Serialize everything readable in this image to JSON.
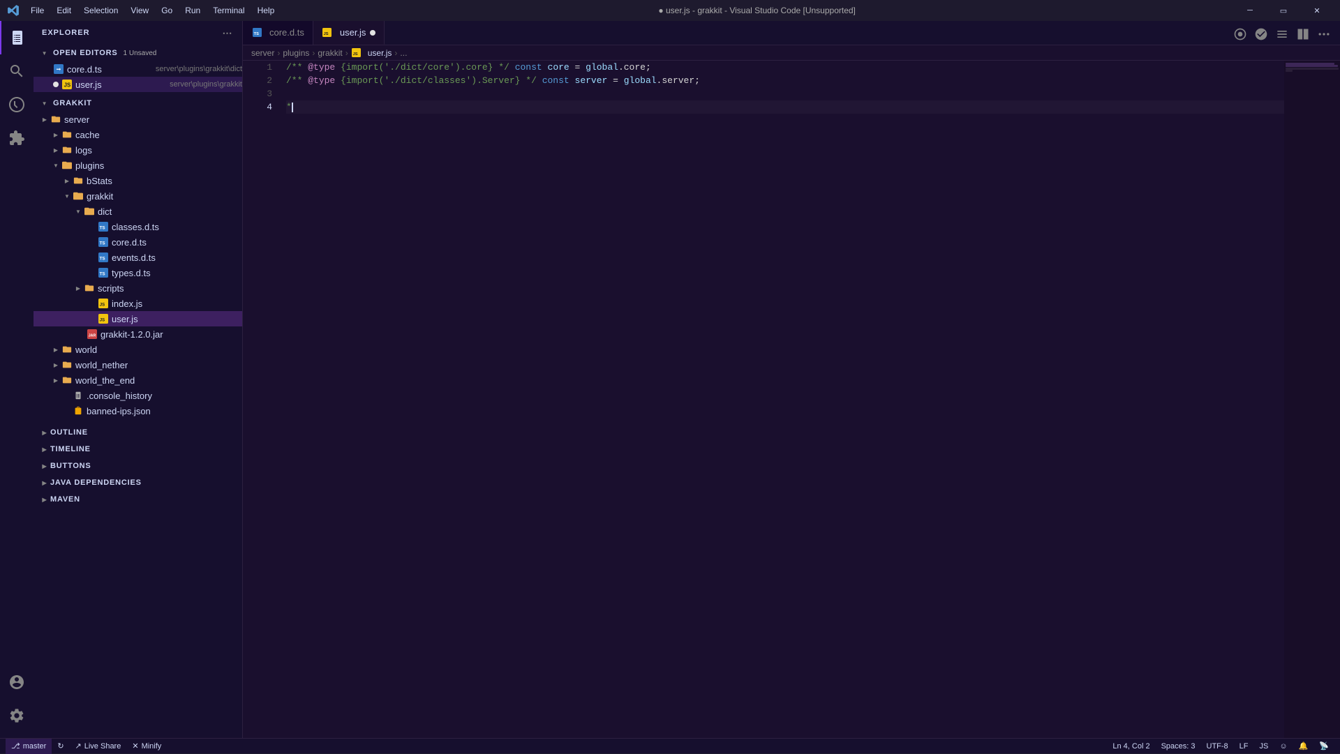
{
  "titleBar": {
    "title": "● user.js - grakkit - Visual Studio Code [Unsupported]",
    "menu": [
      "File",
      "Edit",
      "Selection",
      "View",
      "Go",
      "Run",
      "Terminal",
      "Help"
    ],
    "buttons": [
      "minimize",
      "restore",
      "close"
    ]
  },
  "sidebar": {
    "header": "Explorer",
    "openEditors": {
      "label": "Open Editors",
      "badge": "1",
      "unsaved": "1 Unsaved",
      "items": [
        {
          "name": "core.d.ts",
          "path": "server\\plugins\\grakkit\\dict",
          "icon": "ts",
          "unsaved": false
        },
        {
          "name": "user.js",
          "path": "server\\plugins\\grakkit",
          "icon": "js",
          "unsaved": true
        }
      ]
    },
    "grakkit": {
      "label": "GRAKKIT",
      "expanded": true,
      "items": [
        {
          "type": "folder",
          "name": "server",
          "level": 1,
          "expanded": false,
          "arrow": "right"
        },
        {
          "type": "folder",
          "name": "cache",
          "level": 2,
          "expanded": false,
          "arrow": "right"
        },
        {
          "type": "folder",
          "name": "logs",
          "level": 2,
          "expanded": false,
          "arrow": "right"
        },
        {
          "type": "folder",
          "name": "plugins",
          "level": 2,
          "expanded": true,
          "arrow": "down"
        },
        {
          "type": "folder",
          "name": "bStats",
          "level": 3,
          "expanded": false,
          "arrow": "right"
        },
        {
          "type": "folder",
          "name": "grakkit",
          "level": 3,
          "expanded": true,
          "arrow": "down"
        },
        {
          "type": "folder",
          "name": "dict",
          "level": 4,
          "expanded": true,
          "arrow": "down"
        },
        {
          "type": "file",
          "name": "classes.d.ts",
          "level": 5,
          "icon": "ts"
        },
        {
          "type": "file",
          "name": "core.d.ts",
          "level": 5,
          "icon": "ts"
        },
        {
          "type": "file",
          "name": "events.d.ts",
          "level": 5,
          "icon": "ts"
        },
        {
          "type": "file",
          "name": "types.d.ts",
          "level": 5,
          "icon": "ts"
        },
        {
          "type": "folder",
          "name": "scripts",
          "level": 4,
          "expanded": false,
          "arrow": "right"
        },
        {
          "type": "file",
          "name": "index.js",
          "level": 5,
          "icon": "js"
        },
        {
          "type": "file",
          "name": "user.js",
          "level": 5,
          "icon": "js",
          "active": true
        },
        {
          "type": "file",
          "name": "grakkit-1.2.0.jar",
          "level": 4,
          "icon": "jar"
        },
        {
          "type": "folder",
          "name": "world",
          "level": 2,
          "expanded": false,
          "arrow": "right"
        },
        {
          "type": "folder",
          "name": "world_nether",
          "level": 2,
          "expanded": false,
          "arrow": "right"
        },
        {
          "type": "folder",
          "name": "world_the_end",
          "level": 2,
          "expanded": false,
          "arrow": "right"
        },
        {
          "type": "file",
          "name": ".console_history",
          "level": 2,
          "icon": "history"
        },
        {
          "type": "file",
          "name": "banned-ips.json",
          "level": 2,
          "icon": "json"
        }
      ]
    },
    "bottomSections": [
      {
        "label": "OUTLINE",
        "expanded": false
      },
      {
        "label": "TIMELINE",
        "expanded": false
      },
      {
        "label": "BUTTONS",
        "expanded": false
      },
      {
        "label": "JAVA DEPENDENCIES",
        "expanded": false
      },
      {
        "label": "MAVEN",
        "expanded": false
      }
    ]
  },
  "tabs": [
    {
      "name": "core.d.ts",
      "icon": "ts",
      "unsaved": false,
      "active": false
    },
    {
      "name": "user.js",
      "icon": "js",
      "unsaved": true,
      "active": true
    }
  ],
  "breadcrumb": [
    "server",
    "plugins",
    "grakkit",
    "user.js",
    "..."
  ],
  "editor": {
    "lines": [
      {
        "num": 1,
        "tokens": [
          {
            "text": "/** ",
            "class": "c-comment"
          },
          {
            "text": "@type",
            "class": "c-decorator"
          },
          {
            "text": " {import('./dict/core').core} */ ",
            "class": "c-comment"
          },
          {
            "text": "const",
            "class": "c-keyword"
          },
          {
            "text": " ",
            "class": "c-plain"
          },
          {
            "text": "core",
            "class": "c-variable"
          },
          {
            "text": " = ",
            "class": "c-plain"
          },
          {
            "text": "global",
            "class": "c-variable"
          },
          {
            "text": ".core;",
            "class": "c-plain"
          }
        ]
      },
      {
        "num": 2,
        "tokens": [
          {
            "text": "/** ",
            "class": "c-comment"
          },
          {
            "text": "@type",
            "class": "c-decorator"
          },
          {
            "text": " {import('./dict/classes').Server} */ ",
            "class": "c-comment"
          },
          {
            "text": "const",
            "class": "c-keyword"
          },
          {
            "text": " ",
            "class": "c-plain"
          },
          {
            "text": "server",
            "class": "c-variable"
          },
          {
            "text": " = ",
            "class": "c-plain"
          },
          {
            "text": "global",
            "class": "c-variable"
          },
          {
            "text": ".server;",
            "class": "c-plain"
          }
        ]
      },
      {
        "num": 3,
        "tokens": []
      },
      {
        "num": 4,
        "tokens": [
          {
            "text": "*",
            "class": "c-comment"
          }
        ],
        "hasCursor": true
      }
    ]
  },
  "statusBar": {
    "branch": "master",
    "errors": "",
    "position": "Ln 4, Col 2",
    "spaces": "Spaces: 3",
    "encoding": "UTF-8",
    "lineEnding": "LF",
    "language": "JS",
    "liveShare": "Live Share",
    "minify": "Minify"
  }
}
